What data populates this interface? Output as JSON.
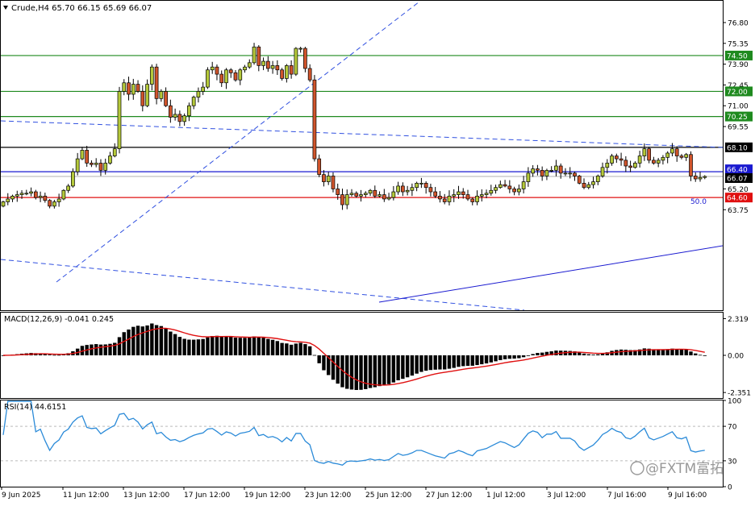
{
  "header": {
    "symbol_line": "Crude,H4  65.70 66.15 65.69 66.07",
    "macd_label": "MACD(12,26,9) -0.041 0.245",
    "rsi_label": "RSI(14) 44.6151"
  },
  "watermark": {
    "text": "@FXTM富拓"
  },
  "colors": {
    "bull": "#b5c93a",
    "bear": "#d0542b",
    "support_green": "#1f8a1f",
    "support_red": "#e01010",
    "blue_line": "#1a1ad0",
    "trend_dash": "#3050e0",
    "macd_signal": "#e01010",
    "rsi_line": "#2a8ad8"
  },
  "chart_data": [
    {
      "type": "candlestick",
      "title": "Crude,H4",
      "ylim": [
        62.9,
        78.1
      ],
      "y_ticks": [
        "76.80",
        "75.35",
        "73.90",
        "72.45",
        "71.00",
        "69.55",
        "65.20",
        "63.75"
      ],
      "x_ticks": [
        "9 Jun 2025",
        "11 Jun 12:00",
        "13 Jun 12:00",
        "17 Jun 12:00",
        "19 Jun 12:00",
        "23 Jun 12:00",
        "25 Jun 12:00",
        "27 Jun 12:00",
        "1 Jul 12:00",
        "3 Jul 12:00",
        "7 Jul 16:00",
        "9 Jul 16:00"
      ],
      "price_tags": {
        "h_74_50": "74.50",
        "h_72_00": "72.00",
        "h_70_25": "70.25",
        "h_68_10": "68.10",
        "h_66_40": "66.40",
        "current": "66.07",
        "h_64_60": "64.60"
      },
      "fib_label": "50.0",
      "horizontal_levels": [
        74.5,
        72.0,
        70.25,
        68.1,
        66.4,
        64.6
      ],
      "current_price": 66.07,
      "closes": [
        64.3,
        64.5,
        64.7,
        64.8,
        64.9,
        64.9,
        65.0,
        64.6,
        64.7,
        64.4,
        64.0,
        64.3,
        64.5,
        65.1,
        65.4,
        66.4,
        67.3,
        67.9,
        67.0,
        66.9,
        67.0,
        66.5,
        67.0,
        67.5,
        68.0,
        72.0,
        72.6,
        71.8,
        72.5,
        72.0,
        71.0,
        72.5,
        73.7,
        71.5,
        72.0,
        71.0,
        70.2,
        70.4,
        69.9,
        70.3,
        71.0,
        71.6,
        72.0,
        72.3,
        73.5,
        73.7,
        73.2,
        72.6,
        73.5,
        73.3,
        72.8,
        73.5,
        73.7,
        74.0,
        75.1,
        73.8,
        74.1,
        73.6,
        73.8,
        73.5,
        72.9,
        73.8,
        73.2,
        75.0,
        75.0,
        73.6,
        72.8,
        67.3,
        66.2,
        65.7,
        66.1,
        65.2,
        64.8,
        64.1,
        64.8,
        64.9,
        64.7,
        64.8,
        64.9,
        65.1,
        64.7,
        64.8,
        64.5,
        64.6,
        65.0,
        65.4,
        65.0,
        65.1,
        65.3,
        65.6,
        65.6,
        65.3,
        65.0,
        64.7,
        64.5,
        64.3,
        64.7,
        64.8,
        65.0,
        64.8,
        64.5,
        64.3,
        64.7,
        64.8,
        64.9,
        65.1,
        65.3,
        65.5,
        65.4,
        65.2,
        65.0,
        65.2,
        65.7,
        66.3,
        66.6,
        66.5,
        66.1,
        66.5,
        66.5,
        66.8,
        66.3,
        66.3,
        66.3,
        66.1,
        65.6,
        65.3,
        65.5,
        65.7,
        66.1,
        66.7,
        67.0,
        67.5,
        67.3,
        67.2,
        66.8,
        66.7,
        67.0,
        67.5,
        68.0,
        67.2,
        67.0,
        67.2,
        67.4,
        67.7,
        68.0,
        67.5,
        67.4,
        67.6,
        66.1,
        65.9,
        66.0,
        66.07
      ],
      "macd_ylim": [
        -2.7,
        2.7
      ],
      "macd_ticks": [
        "2.319",
        "0.00",
        "-2.351"
      ],
      "rsi_ylim": [
        0,
        100
      ],
      "rsi_ticks": [
        "100",
        "70",
        "30",
        "0"
      ]
    }
  ]
}
